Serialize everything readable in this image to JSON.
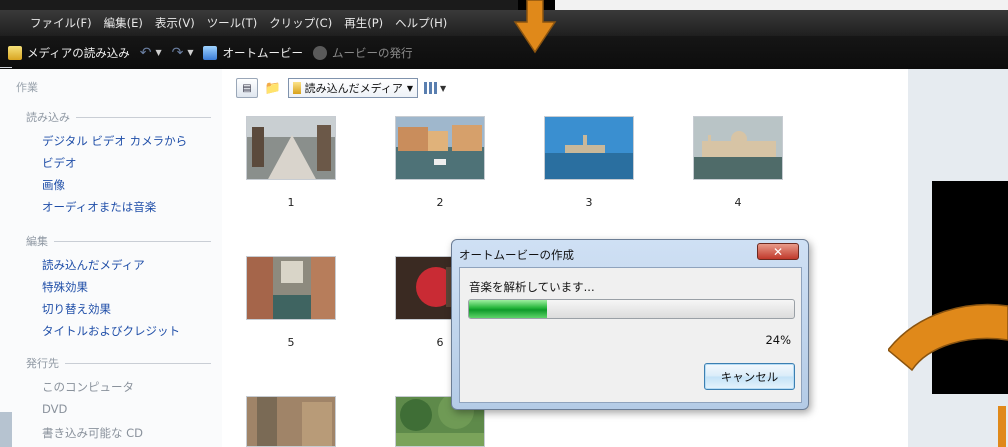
{
  "menu": {
    "items": [
      "ファイル(F)",
      "編集(E)",
      "表示(V)",
      "ツール(T)",
      "クリップ(C)",
      "再生(P)",
      "ヘルプ(H)"
    ]
  },
  "toolbar": {
    "import_label": "メディアの読み込み",
    "automovie_label": "オートムービー",
    "publish_label": "ムービーの発行"
  },
  "taskpane": {
    "title": "作業",
    "sections": [
      {
        "heading": "読み込み",
        "links": [
          "デジタル ビデオ カメラから",
          "ビデオ",
          "画像",
          "オーディオまたは音楽"
        ]
      },
      {
        "heading": "編集",
        "links": [
          "読み込んだメディア",
          "特殊効果",
          "切り替え効果",
          "タイトルおよびクレジット"
        ]
      },
      {
        "heading": "発行先",
        "links": [
          "このコンピュータ",
          "DVD",
          "書き込み可能な CD"
        ]
      }
    ]
  },
  "content": {
    "collection_select": "読み込んだメディア",
    "thumbnails": [
      {
        "label": "1"
      },
      {
        "label": "2"
      },
      {
        "label": "3"
      },
      {
        "label": "4"
      },
      {
        "label": "5"
      },
      {
        "label": "6"
      },
      {
        "label": ""
      },
      {
        "label": ""
      }
    ]
  },
  "dialog": {
    "title": "オートムービーの作成",
    "message": "音楽を解析しています...",
    "progress": 0.24,
    "progress_text": "24%",
    "cancel_label": "キャンセル"
  },
  "colors": {
    "accent_orange": "#e0891a",
    "progress_green": "#22b338",
    "link_blue": "#1f4ea8"
  }
}
